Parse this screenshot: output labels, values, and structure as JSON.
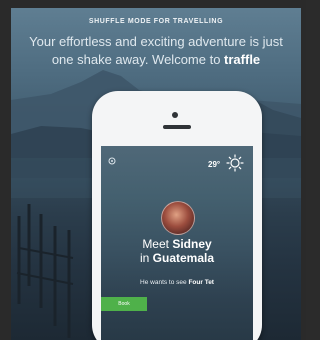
{
  "header": {
    "kicker": "SHUFFLE MODE FOR TRAVELLING",
    "line1": "Your effortless and exciting adventure is just",
    "line2_prefix": "one shake away. Welcome to ",
    "brand": "traffle"
  },
  "phone": {
    "temperature": "29°",
    "meet_prefix": "Meet ",
    "person_name": "Sidney",
    "in_prefix": "in ",
    "place": "Guatemala",
    "wants_prefix": "He wants to see ",
    "wants_target": "Four Tet",
    "button_label": "Book"
  },
  "icons": {
    "settings": "gear-icon",
    "weather": "sun-icon",
    "avatar": "user-avatar"
  },
  "colors": {
    "accent_green": "#4fb14a"
  }
}
